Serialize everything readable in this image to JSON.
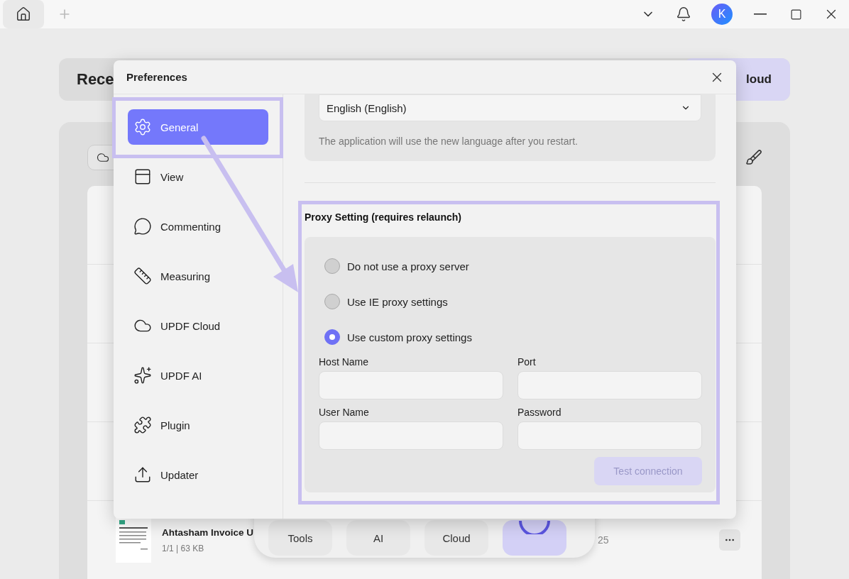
{
  "titlebar": {
    "avatar": "K"
  },
  "home": {
    "header_title": "Rece",
    "header_button": "loud",
    "file": {
      "name": "Ahtasham Invoice U",
      "meta": "1/1 | 63 KB",
      "date": "25"
    }
  },
  "toolbar": {
    "buttons": [
      "Tools",
      "AI",
      "Cloud"
    ]
  },
  "dialog": {
    "title": "Preferences",
    "sidebar": {
      "items": [
        {
          "label": "General",
          "selected": true
        },
        {
          "label": "View",
          "selected": false
        },
        {
          "label": "Commenting",
          "selected": false
        },
        {
          "label": "Measuring",
          "selected": false
        },
        {
          "label": "UPDF Cloud",
          "selected": false
        },
        {
          "label": "UPDF AI",
          "selected": false
        },
        {
          "label": "Plugin",
          "selected": false
        },
        {
          "label": "Updater",
          "selected": false
        }
      ]
    },
    "language": {
      "value": "English (English)",
      "hint": "The application will use the new language after you restart."
    },
    "proxy": {
      "title": "Proxy Setting (requires relaunch)",
      "options": [
        {
          "label": "Do not use a proxy server",
          "selected": false
        },
        {
          "label": "Use IE proxy settings",
          "selected": false
        },
        {
          "label": "Use custom proxy settings",
          "selected": true
        }
      ],
      "fields": [
        {
          "label": "Host Name"
        },
        {
          "label": "Port"
        },
        {
          "label": "User Name"
        },
        {
          "label": "Password"
        }
      ],
      "test_button": {
        "label": "Test connection",
        "disabled": true
      }
    }
  }
}
